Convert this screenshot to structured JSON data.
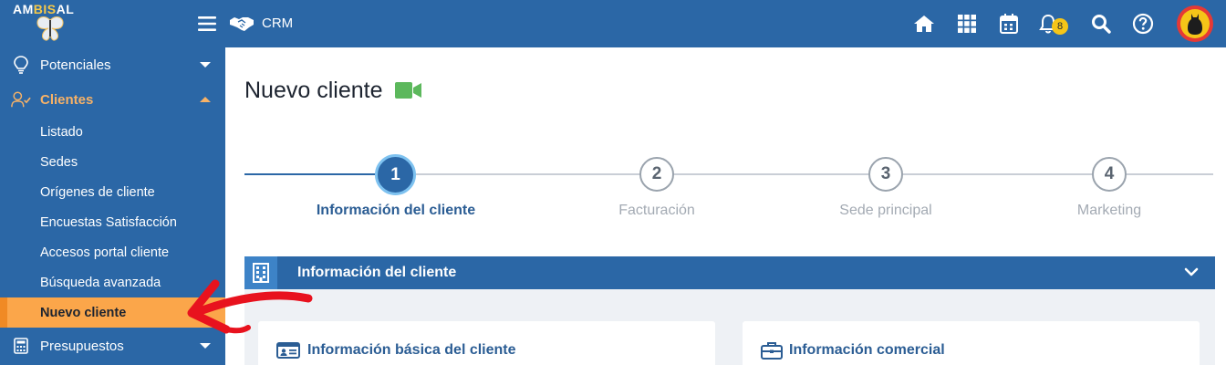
{
  "app": {
    "brand_part1": "AM",
    "brand_highlight": "BIS",
    "brand_part2": "AL"
  },
  "sidebar": {
    "items": [
      {
        "label": "Potenciales",
        "icon": "lightbulb-icon"
      },
      {
        "label": "Clientes",
        "icon": "user-check-icon"
      },
      {
        "label": "Presupuestos",
        "icon": "calculator-icon"
      }
    ],
    "clientes_sub": [
      {
        "label": "Listado"
      },
      {
        "label": "Sedes"
      },
      {
        "label": "Orígenes de cliente"
      },
      {
        "label": "Encuestas Satisfacción"
      },
      {
        "label": "Accesos portal cliente"
      },
      {
        "label": "Búsqueda avanzada"
      },
      {
        "label": "Nuevo cliente"
      }
    ]
  },
  "topbar": {
    "module_label": "CRM",
    "notifications_count": "8",
    "icons": [
      "menu-icon",
      "handshake-icon",
      "home-icon",
      "grid-icon",
      "calendar-icon",
      "bell-icon",
      "search-icon",
      "help-icon",
      "avatar"
    ]
  },
  "page": {
    "title": "Nuevo cliente"
  },
  "stepper": {
    "steps": [
      {
        "number": "1",
        "label": "Información del cliente",
        "active": true
      },
      {
        "number": "2",
        "label": "Facturación",
        "active": false
      },
      {
        "number": "3",
        "label": "Sede principal",
        "active": false
      },
      {
        "number": "4",
        "label": "Marketing",
        "active": false
      }
    ]
  },
  "section": {
    "title": "Información del cliente",
    "cards": [
      {
        "title": "Información básica del cliente",
        "icon": "id-card-icon"
      },
      {
        "title": "Información comercial",
        "icon": "briefcase-icon"
      }
    ]
  },
  "colors": {
    "primary": "#2b67a6",
    "highlight": "#fba64a",
    "accent_green": "#5cb85c",
    "arrow_red": "#e8121e"
  }
}
